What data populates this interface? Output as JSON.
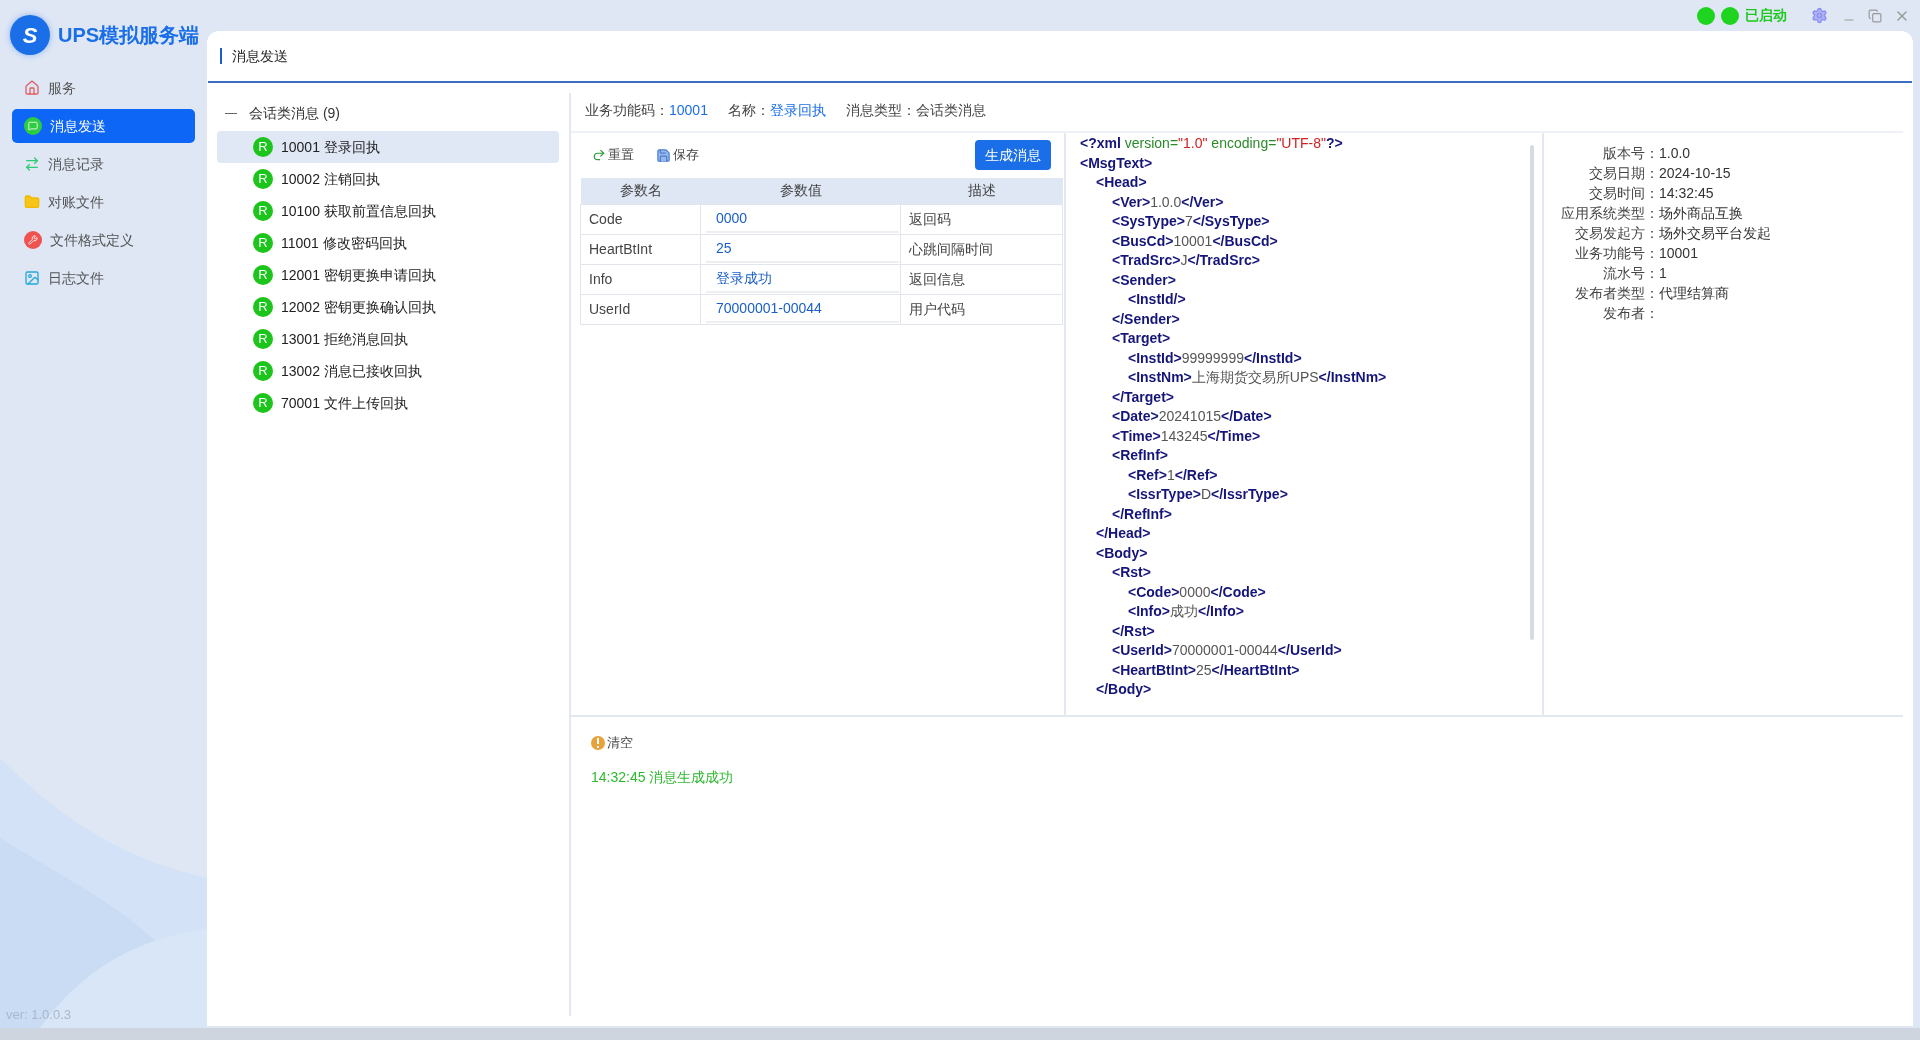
{
  "app": {
    "logo_mark": "S",
    "title": "UPS模拟服务端",
    "version": "ver: 1.0.0.3"
  },
  "window_status": {
    "label": "已启动"
  },
  "sidebar": {
    "items": [
      {
        "label": "服务",
        "selected": false
      },
      {
        "label": "消息发送",
        "selected": true
      },
      {
        "label": "消息记录",
        "selected": false
      },
      {
        "label": "对账文件",
        "selected": false
      },
      {
        "label": "文件格式定义",
        "selected": false
      },
      {
        "label": "日志文件",
        "selected": false
      }
    ]
  },
  "page_title": "消息发送",
  "tree": {
    "label": "会话类消息 (9)",
    "expanded": true,
    "children": [
      {
        "badge": "R",
        "label": "10001 登录回执",
        "selected": true
      },
      {
        "badge": "R",
        "label": "10002 注销回执",
        "selected": false
      },
      {
        "badge": "R",
        "label": "10100 获取前置信息回执",
        "selected": false
      },
      {
        "badge": "R",
        "label": "11001 修改密码回执",
        "selected": false
      },
      {
        "badge": "R",
        "label": "12001 密钥更换申请回执",
        "selected": false
      },
      {
        "badge": "R",
        "label": "12002 密钥更换确认回执",
        "selected": false
      },
      {
        "badge": "R",
        "label": "13001 拒绝消息回执",
        "selected": false
      },
      {
        "badge": "R",
        "label": "13002 消息已接收回执",
        "selected": false
      },
      {
        "badge": "R",
        "label": "70001 文件上传回执",
        "selected": false
      }
    ]
  },
  "info_bar": [
    {
      "label": "业务功能码：",
      "value": "10001",
      "link": true
    },
    {
      "label": "名称：",
      "value": "登录回执",
      "link": true
    },
    {
      "label": "消息类型：",
      "value": "会话类消息",
      "link": false
    }
  ],
  "toolbar": {
    "reset": "重置",
    "save": "保存",
    "generate": "生成消息"
  },
  "table": {
    "columns": [
      "参数名",
      "参数值",
      "描述"
    ],
    "rows": [
      {
        "name": "Code",
        "value": "0000",
        "description": "返回码"
      },
      {
        "name": "HeartBtInt",
        "value": "25",
        "description": "心跳间隔时间"
      },
      {
        "name": "Info",
        "value": "登录成功",
        "description": "返回信息"
      },
      {
        "name": "UserId",
        "value": "70000001-00044",
        "description": "用户代码"
      }
    ]
  },
  "xml": {
    "declaration": [
      {
        "text": "<?xml",
        "kind": "tag"
      },
      {
        "text": " version=",
        "kind": "attr"
      },
      {
        "text": "\"1.0\"",
        "kind": "string"
      },
      {
        "text": " encoding=",
        "kind": "attr"
      },
      {
        "text": "\"UTF-8\"",
        "kind": "string"
      },
      {
        "text": "?>",
        "kind": "tag"
      }
    ],
    "root": {
      "open": "<MsgText>",
      "children": [
        {
          "open": "<Head>",
          "close": "</Head>",
          "children": [
            {
              "open": "<Ver>",
              "value": "1.0.0",
              "close": "</Ver>"
            },
            {
              "open": "<SysType>",
              "value": "7",
              "close": "</SysType>"
            },
            {
              "open": "<BusCd>",
              "value": "10001",
              "close": "</BusCd>"
            },
            {
              "open": "<TradSrc>",
              "value": "J",
              "close": "</TradSrc>"
            },
            {
              "open": "<Sender>",
              "close": "</Sender>",
              "children": [
                {
                  "open": "<InstId/>"
                }
              ]
            },
            {
              "open": "<Target>",
              "close": "</Target>",
              "children": [
                {
                  "open": "<InstId>",
                  "value": "99999999",
                  "close": "</InstId>"
                },
                {
                  "open": "<InstNm>",
                  "value": "上海期货交易所UPS",
                  "close": "</InstNm>"
                }
              ]
            },
            {
              "open": "<Date>",
              "value": "20241015",
              "close": "</Date>"
            },
            {
              "open": "<Time>",
              "value": "143245",
              "close": "</Time>"
            },
            {
              "open": "<RefInf>",
              "close": "</RefInf>",
              "children": [
                {
                  "open": "<Ref>",
                  "value": "1",
                  "close": "</Ref>"
                },
                {
                  "open": "<IssrType>",
                  "value": "D",
                  "close": "</IssrType>"
                }
              ]
            }
          ]
        },
        {
          "open": "<Body>",
          "close": "</Body>",
          "children": [
            {
              "open": "<Rst>",
              "close": "</Rst>",
              "children": [
                {
                  "open": "<Code>",
                  "value": "0000",
                  "close": "</Code>"
                },
                {
                  "open": "<Info>",
                  "value": "成功",
                  "close": "</Info>"
                }
              ]
            },
            {
              "open": "<UserId>",
              "value": "70000001-00044",
              "close": "</UserId>"
            },
            {
              "open": "<HeartBtInt>",
              "value": "25",
              "close": "</HeartBtInt>"
            }
          ]
        }
      ]
    }
  },
  "header_fields": [
    {
      "label": "版本号：",
      "value": "1.0.0"
    },
    {
      "label": "交易日期：",
      "value": "2024-10-15"
    },
    {
      "label": "交易时间：",
      "value": "14:32:45"
    },
    {
      "label": "应用系统类型：",
      "value": "场外商品互换"
    },
    {
      "label": "交易发起方：",
      "value": "场外交易平台发起"
    },
    {
      "label": "业务功能号：",
      "value": "10001"
    },
    {
      "label": "流水号：",
      "value": "1"
    },
    {
      "label": "发布者类型：",
      "value": "代理结算商"
    },
    {
      "label": "发布者："
    }
  ],
  "log": {
    "clear": "清空",
    "entries": [
      "14:32:45 消息生成成功"
    ]
  }
}
